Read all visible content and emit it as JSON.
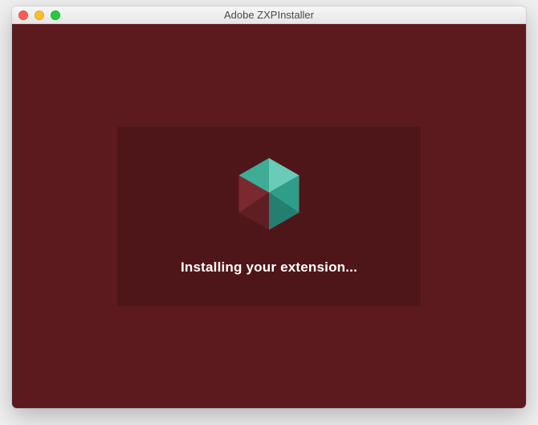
{
  "window": {
    "title": "Adobe ZXPInstaller"
  },
  "main": {
    "status": "Installing your extension..."
  },
  "colors": {
    "background": "#5d1a1e",
    "card": "rgba(0,0,0,0.15)"
  },
  "icons": {
    "app_logo": "cube-icon"
  }
}
